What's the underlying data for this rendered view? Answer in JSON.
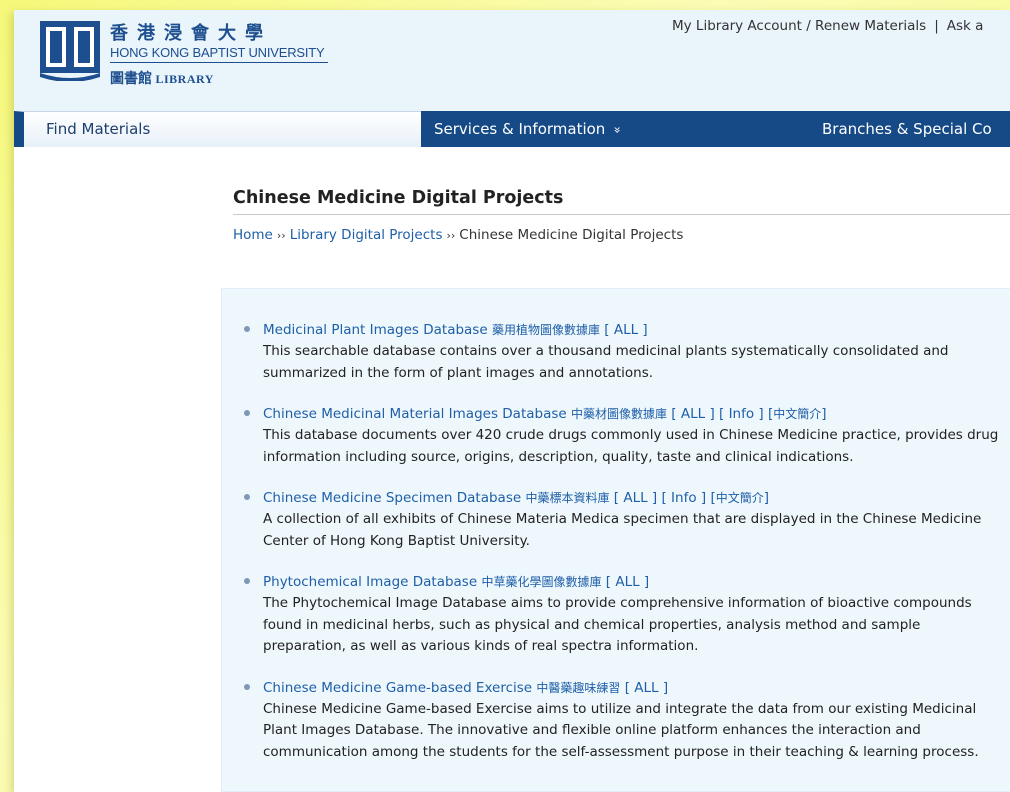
{
  "header": {
    "logo_cn": "香港浸會大學",
    "logo_en": "HONG KONG BAPTIST UNIVERSITY",
    "logo_lib_cn": "圖書館",
    "logo_lib_en": "LIBRARY",
    "account_link": "My Library Account / Renew Materials",
    "separator": "|",
    "ask_link": "Ask a"
  },
  "nav": {
    "find": "Find Materials",
    "services": "Services & Information",
    "services_chevron": "»",
    "branches": "Branches & Special Co"
  },
  "page": {
    "title": "Chinese Medicine Digital Projects",
    "breadcrumb": {
      "home": "Home",
      "sep": "››",
      "parent": "Library Digital Projects",
      "current": "Chinese Medicine Digital Projects"
    }
  },
  "projects": [
    {
      "title": "Medicinal Plant Images Database",
      "title_cn": "藥用植物圖像數據庫",
      "links": [
        "ALL"
      ],
      "description": "This searchable database contains over a thousand medicinal plants systematically consolidated and summarized in the form of plant images and annotations."
    },
    {
      "title": "Chinese Medicinal Material Images Database",
      "title_cn": "中藥材圖像數據庫",
      "links": [
        "ALL",
        "Info",
        "中文簡介"
      ],
      "description": "This database documents over 420 crude drugs commonly used in Chinese Medicine practice, provides drug information including source, origins, description, quality, taste and clinical indications."
    },
    {
      "title": "Chinese Medicine Specimen Database",
      "title_cn": "中藥標本資料庫",
      "links": [
        "ALL",
        "Info",
        "中文簡介"
      ],
      "description": "A collection of all exhibits of Chinese Materia Medica specimen that are displayed in the Chinese Medicine Center of Hong Kong Baptist University."
    },
    {
      "title": "Phytochemical Image Database",
      "title_cn": "中草藥化學圖像數據庫",
      "links": [
        "ALL"
      ],
      "description": "The Phytochemical Image Database aims to provide comprehensive information of bioactive compounds found in medicinal herbs, such as physical and chemical properties, analysis method and sample preparation, as well as various kinds of real spectra information."
    },
    {
      "title": "Chinese Medicine Game-based Exercise",
      "title_cn": "中醫藥趣味練習",
      "links": [
        "ALL"
      ],
      "description": "Chinese Medicine Game-based Exercise aims to utilize and integrate the data from our existing Medicinal Plant Images Database. The innovative and flexible online platform enhances the interaction and communication among the students for the self-assessment purpose in their teaching & learning process."
    }
  ],
  "colors": {
    "link": "#1f5fa8",
    "nav_bg": "#154a86",
    "header_bg": "#eaf4fb",
    "panel_bg": "#eef7fc",
    "outer_bg": "#f6f87a"
  }
}
